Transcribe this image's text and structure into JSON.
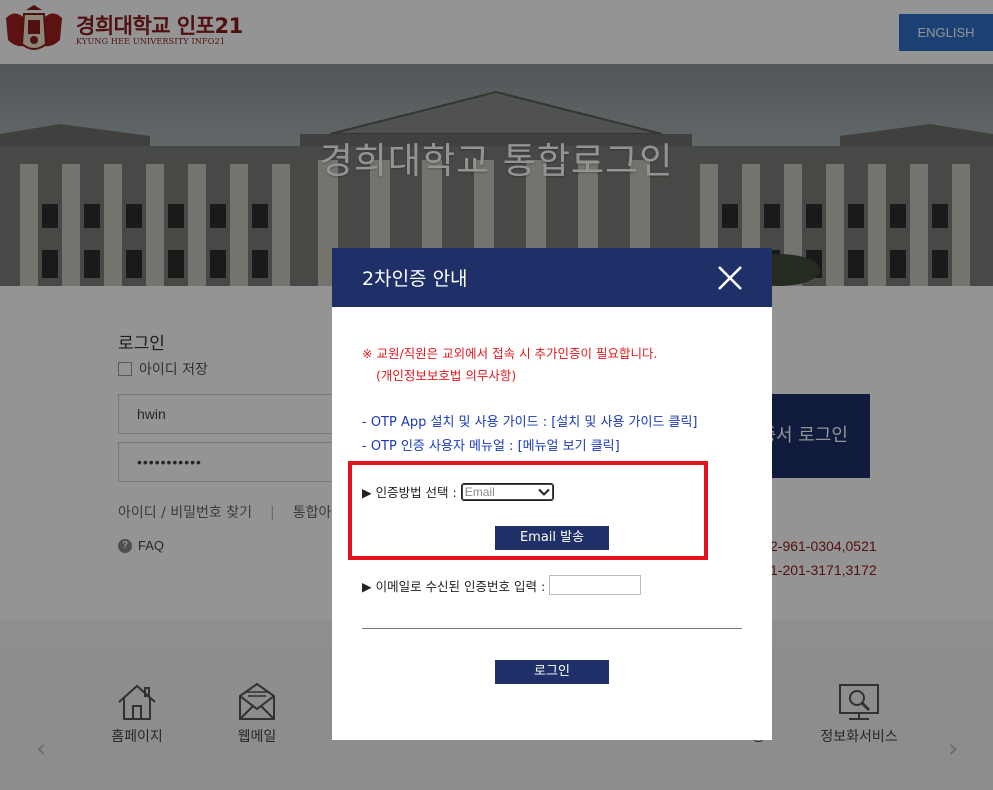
{
  "header": {
    "logo_title": "경희대학교 인포21",
    "logo_sub": "KYUNG HEE UNIVERSITY INFO21",
    "english_label": "ENGLISH"
  },
  "hero": {
    "title": "경희대학교 통합로그인"
  },
  "login": {
    "heading": "로그인",
    "save_id_label": "아이디 저장",
    "id_value": "hwin",
    "password_mask": "•••••••••••",
    "find_id_pw": "아이디 / 비밀번호 찾기",
    "separator": "|",
    "integrated_partial": "통합아",
    "faq": "FAQ",
    "faq_icon": "?",
    "cert_login_partial": "증서 로그인",
    "phone1_partial": "2-961-0304,0521",
    "phone2_partial": "1-201-3171,3172"
  },
  "quick_menu": {
    "items": [
      {
        "label": "홈페이지",
        "icon": "home-icon"
      },
      {
        "label": "웹메일",
        "icon": "mail-icon"
      },
      {
        "label": "청",
        "icon": ""
      },
      {
        "label": "정보화서비스",
        "icon": "monitor-search-icon"
      }
    ],
    "prev_arrow": "‹",
    "next_arrow": "›",
    "dots": {
      "count": 2,
      "active_index": 0
    }
  },
  "modal": {
    "title": "2차인증 안내",
    "notice_line1": "※ 교원/직원은 교외에서 접속 시 추가인증이 필요합니다.",
    "notice_line2": "(개인정보보호법 의무사항)",
    "guide1_prefix": "- OTP App 설치 및 사용 가이드 : ",
    "guide1_link": "[설치 및 사용 가이드 클릭]",
    "guide2_prefix": "- OTP 인증 사용자 메뉴얼 : ",
    "guide2_link": "[메뉴얼 보기 클릭]",
    "method_label": "▶ 인증방법 선택 :",
    "method_value": "Email",
    "email_send_button": "Email 발송",
    "code_label": "▶ 이메일로 수신된 인증번호 입력 :",
    "code_value": "",
    "login_button": "로그인"
  },
  "colors": {
    "navy": "#1f3069",
    "brand_red": "#8b1c1c",
    "highlight_red": "#e3141b",
    "notice_red": "#e0191e",
    "link_blue": "#1a3ab8",
    "english_blue": "#2e6fc8"
  }
}
